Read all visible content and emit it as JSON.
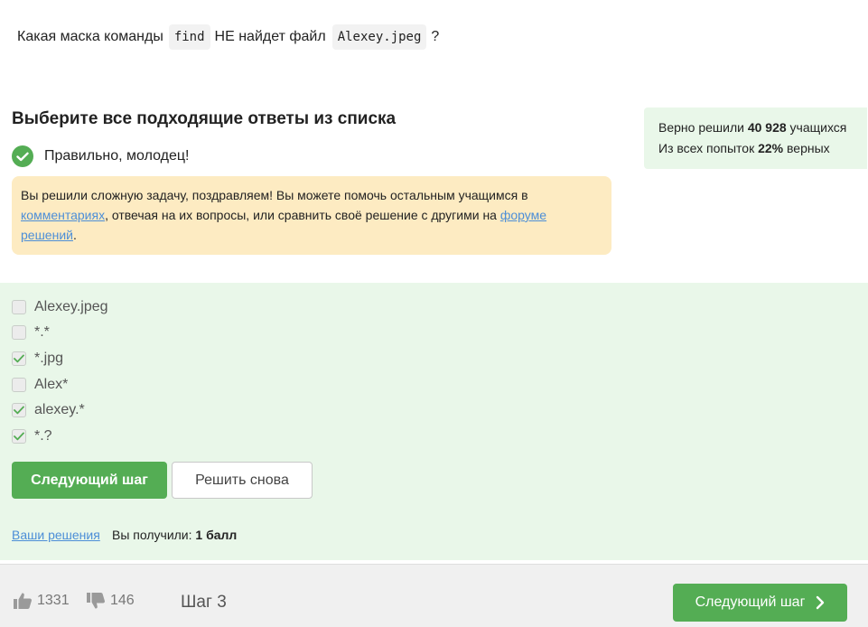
{
  "question": {
    "prefix": "Какая маска команды",
    "command": "find",
    "middle": "НЕ найдет файл",
    "filename": "Alexey.jpeg",
    "suffix": "?"
  },
  "section_title": "Выберите все подходящие ответы из списка",
  "feedback": {
    "correct_text": "Правильно, молодец!",
    "hint_part1": "Вы решили сложную задачу, поздравляем! Вы можете помочь остальным учащимся в ",
    "hint_link1": "комментариях",
    "hint_part2": ", отвечая на их вопросы, или сравнить своё решение с другими на ",
    "hint_link2": "форуме решений",
    "hint_part3": "."
  },
  "stats": {
    "line1_prefix": "Верно решили ",
    "solved_count": "40 928",
    "line1_suffix": " учащихся",
    "line2_prefix": "Из всех попыток ",
    "percent": "22%",
    "line2_suffix": " верных"
  },
  "options": [
    {
      "label": "Alexey.jpeg",
      "checked": false
    },
    {
      "label": "*.*",
      "checked": false
    },
    {
      "label": "*.jpg",
      "checked": true
    },
    {
      "label": "Alex*",
      "checked": false
    },
    {
      "label": "alexey.*",
      "checked": true
    },
    {
      "label": "*.?",
      "checked": true
    }
  ],
  "buttons": {
    "next_step": "Следующий шаг",
    "retry": "Решить снова"
  },
  "your_solutions": "Ваши решения",
  "score": {
    "prefix": "Вы получили: ",
    "value": "1 балл"
  },
  "footer": {
    "likes": "1331",
    "dislikes": "146",
    "step": "Шаг 3",
    "next_label": "Следующий шаг"
  },
  "colors": {
    "accent_green": "#54ad54",
    "panel_green": "#e9f7e9",
    "hint_yellow": "#fdebc2",
    "link_blue": "#4c8ed7"
  }
}
